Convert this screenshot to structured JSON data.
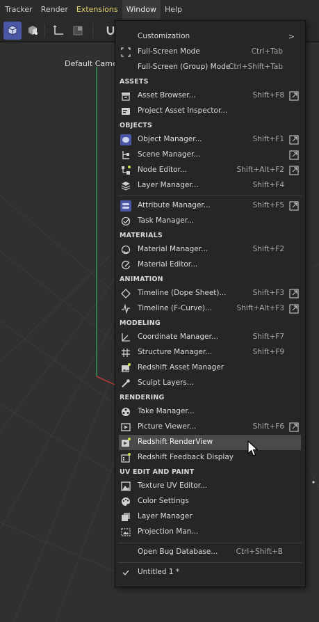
{
  "menubar": {
    "items": [
      {
        "label": "Tracker"
      },
      {
        "label": "Render"
      },
      {
        "label": "Extensions"
      },
      {
        "label": "Window"
      },
      {
        "label": "Help"
      }
    ]
  },
  "viewport": {
    "camera_label": "Default Camer"
  },
  "window_menu": {
    "top": [
      {
        "label": "Customization",
        "shortcut": "",
        "icon": "",
        "submenu": true
      },
      {
        "label": "Full-Screen Mode",
        "shortcut": "Ctrl+Tab",
        "icon": "fullscreen-icon"
      },
      {
        "label": "Full-Screen (Group) Mode",
        "shortcut": "Ctrl+Shift+Tab",
        "icon": ""
      }
    ],
    "sections": {
      "assets": "ASSETS",
      "objects": "OBJECTS",
      "materials": "MATERIALS",
      "animation": "ANIMATION",
      "modeling": "MODELING",
      "rendering": "RENDERING",
      "uv": "UV EDIT AND PAINT"
    },
    "assets": [
      {
        "label": "Asset Browser...",
        "shortcut": "Shift+F8",
        "icon": "asset-browser-icon",
        "popout": true
      },
      {
        "label": "Project Asset Inspector...",
        "shortcut": "",
        "icon": "asset-inspector-icon"
      }
    ],
    "objects": [
      {
        "label": "Object Manager...",
        "shortcut": "Shift+F1",
        "icon": "object-manager-icon",
        "popout": true
      },
      {
        "label": "Scene Manager...",
        "shortcut": "",
        "icon": "scene-manager-icon",
        "popout": true
      },
      {
        "label": "Node Editor...",
        "shortcut": "Shift+Alt+F2",
        "icon": "node-editor-icon",
        "popout": true
      },
      {
        "label": "Layer Manager...",
        "shortcut": "Shift+F4",
        "icon": "layer-manager-icon"
      }
    ],
    "objects2": [
      {
        "label": "Attribute Manager...",
        "shortcut": "Shift+F5",
        "icon": "attribute-manager-icon",
        "popout": true
      },
      {
        "label": "Task Manager...",
        "shortcut": "",
        "icon": "task-manager-icon"
      }
    ],
    "materials": [
      {
        "label": "Material Manager...",
        "shortcut": "Shift+F2",
        "icon": "material-manager-icon"
      },
      {
        "label": "Material Editor...",
        "shortcut": "",
        "icon": "material-editor-icon"
      }
    ],
    "animation": [
      {
        "label": "Timeline (Dope Sheet)...",
        "shortcut": "Shift+F3",
        "icon": "keyframe-icon",
        "popout": true
      },
      {
        "label": "Timeline (F-Curve)...",
        "shortcut": "Shift+Alt+F3",
        "icon": "fcurve-icon",
        "popout": true
      }
    ],
    "modeling": [
      {
        "label": "Coordinate Manager...",
        "shortcut": "Shift+F7",
        "icon": "coordinate-icon"
      },
      {
        "label": "Structure Manager...",
        "shortcut": "Shift+F9",
        "icon": "structure-icon"
      },
      {
        "label": "Redshift Asset Manager",
        "shortcut": "",
        "icon": "redshift-asset-icon"
      },
      {
        "label": "Sculpt Layers...",
        "shortcut": "",
        "icon": "sculpt-icon"
      }
    ],
    "rendering": [
      {
        "label": "Take Manager...",
        "shortcut": "",
        "icon": "take-manager-icon"
      },
      {
        "label": "Picture Viewer...",
        "shortcut": "Shift+F6",
        "icon": "picture-viewer-icon",
        "popout": true
      },
      {
        "label": "Redshift RenderView",
        "shortcut": "",
        "icon": "renderview-icon"
      },
      {
        "label": "Redshift Feedback Display",
        "shortcut": "",
        "icon": "feedback-display-icon"
      }
    ],
    "uv": [
      {
        "label": "Texture UV Editor...",
        "shortcut": "",
        "icon": "texture-uv-icon"
      },
      {
        "label": "Color Settings",
        "shortcut": "",
        "icon": "palette-icon"
      },
      {
        "label": "Layer Manager",
        "shortcut": "",
        "icon": "layers-icon"
      },
      {
        "label": "Projection Man...",
        "shortcut": "",
        "icon": "projection-icon"
      }
    ],
    "bottom": [
      {
        "label": "Open Bug Database...",
        "shortcut": "Ctrl+Shift+B",
        "icon": ""
      },
      {
        "label": "Untitled 1 *",
        "shortcut": "",
        "icon": "checkmark-icon"
      }
    ]
  },
  "colors": {
    "accent": "#4a57a7",
    "extensions": "#e3d46c",
    "axis_green": "#35a35a",
    "axis_red": "#c83a3a"
  }
}
